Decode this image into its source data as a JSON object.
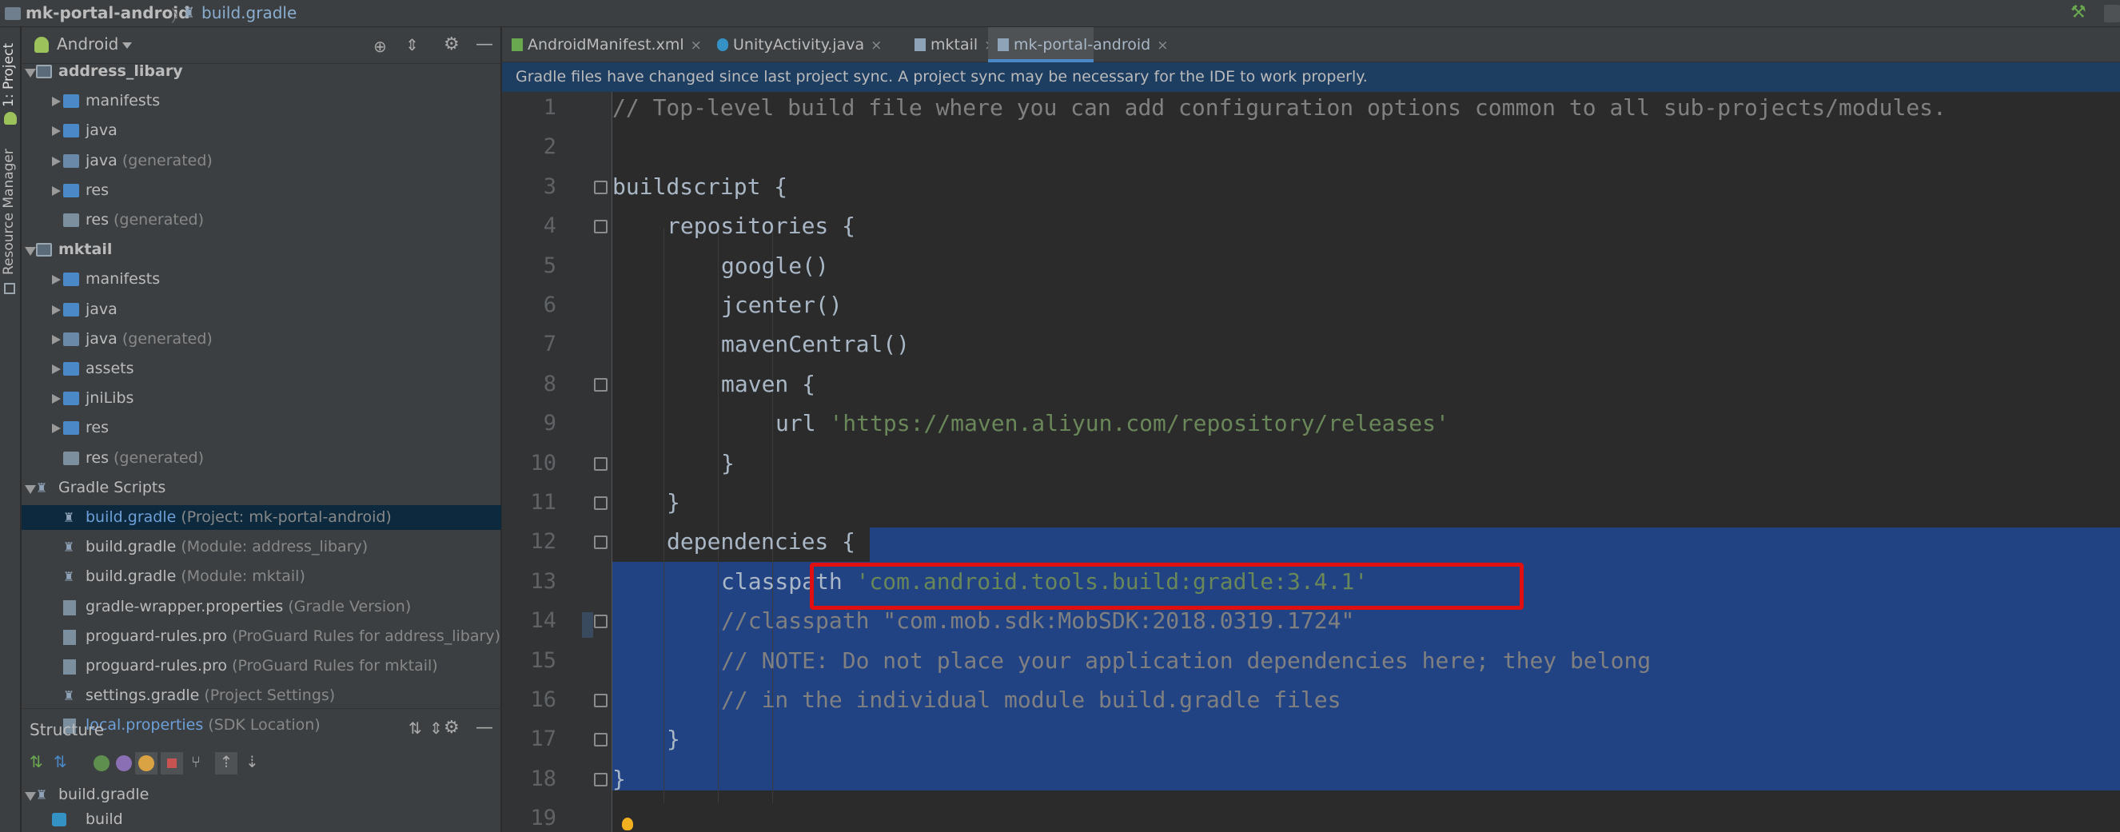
{
  "breadcrumb": {
    "project": "mk-portal-android",
    "file": "build.gradle"
  },
  "left_tool_tabs": {
    "project": "1: Project",
    "resource_manager": "Resource Manager"
  },
  "project_panel": {
    "view_selector": "Android",
    "tree": [
      {
        "label": "address_libary",
        "hint": "",
        "depth": 0,
        "expanded": true,
        "icon": "module-icon",
        "bold": true
      },
      {
        "label": "manifests",
        "hint": "",
        "depth": 1,
        "expanded": false,
        "icon": "folder-icon"
      },
      {
        "label": "java",
        "hint": "",
        "depth": 1,
        "expanded": false,
        "icon": "folder-icon"
      },
      {
        "label": "java",
        "hint": "(generated)",
        "depth": 1,
        "expanded": false,
        "icon": "generated-folder-icon"
      },
      {
        "label": "res",
        "hint": "",
        "depth": 1,
        "expanded": false,
        "icon": "folder-icon"
      },
      {
        "label": "res",
        "hint": "(generated)",
        "depth": 1,
        "expanded": null,
        "icon": "res-folder-icon"
      },
      {
        "label": "mktail",
        "hint": "",
        "depth": 0,
        "expanded": true,
        "icon": "module-icon",
        "bold": true
      },
      {
        "label": "manifests",
        "hint": "",
        "depth": 1,
        "expanded": false,
        "icon": "folder-icon"
      },
      {
        "label": "java",
        "hint": "",
        "depth": 1,
        "expanded": false,
        "icon": "folder-icon"
      },
      {
        "label": "java",
        "hint": "(generated)",
        "depth": 1,
        "expanded": false,
        "icon": "generated-folder-icon"
      },
      {
        "label": "assets",
        "hint": "",
        "depth": 1,
        "expanded": false,
        "icon": "folder-icon"
      },
      {
        "label": "jniLibs",
        "hint": "",
        "depth": 1,
        "expanded": false,
        "icon": "folder-icon"
      },
      {
        "label": "res",
        "hint": "",
        "depth": 1,
        "expanded": false,
        "icon": "folder-icon"
      },
      {
        "label": "res",
        "hint": "(generated)",
        "depth": 1,
        "expanded": null,
        "icon": "res-folder-icon"
      },
      {
        "label": "Gradle Scripts",
        "hint": "",
        "depth": 0,
        "expanded": true,
        "icon": "gradle-icon"
      },
      {
        "label": "build.gradle",
        "hint": "(Project: mk-portal-android)",
        "depth": 1,
        "expanded": null,
        "icon": "gradle-icon",
        "selected": true
      },
      {
        "label": "build.gradle",
        "hint": "(Module: address_libary)",
        "depth": 1,
        "expanded": null,
        "icon": "gradle-icon"
      },
      {
        "label": "build.gradle",
        "hint": "(Module: mktail)",
        "depth": 1,
        "expanded": null,
        "icon": "gradle-icon"
      },
      {
        "label": "gradle-wrapper.properties",
        "hint": "(Gradle Version)",
        "depth": 1,
        "expanded": null,
        "icon": "properties-file-icon"
      },
      {
        "label": "proguard-rules.pro",
        "hint": "(ProGuard Rules for address_libary)",
        "depth": 1,
        "expanded": null,
        "icon": "file-icon"
      },
      {
        "label": "proguard-rules.pro",
        "hint": "(ProGuard Rules for mktail)",
        "depth": 1,
        "expanded": null,
        "icon": "file-icon"
      },
      {
        "label": "settings.gradle",
        "hint": "(Project Settings)",
        "depth": 1,
        "expanded": null,
        "icon": "gradle-icon"
      },
      {
        "label": "local.properties",
        "hint": "(SDK Location)",
        "depth": 1,
        "expanded": null,
        "icon": "properties-file-icon",
        "link_color": true
      }
    ]
  },
  "structure_panel": {
    "title": "Structure",
    "tree": [
      {
        "label": "build.gradle",
        "depth": 0,
        "expanded": true
      },
      {
        "label": "build",
        "depth": 1,
        "expanded": null
      }
    ]
  },
  "editor": {
    "tabs": [
      {
        "label": "AndroidManifest.xml",
        "icon": "xml-file-icon",
        "active": false
      },
      {
        "label": "UnityActivity.java",
        "icon": "java-class-icon",
        "active": false
      },
      {
        "label": "mktail",
        "icon": "gradle-icon",
        "active": false
      },
      {
        "label": "mk-portal-android",
        "icon": "gradle-icon",
        "active": true
      }
    ],
    "notification": "Gradle files have changed since last project sync. A project sync may be necessary for the IDE to work properly.",
    "lines": [
      {
        "n": "1",
        "indent": 0,
        "parts": [
          {
            "t": "// Top-level build file where you can add configuration options common to all sub-projects/modules.",
            "c": "cm"
          }
        ]
      },
      {
        "n": "2",
        "indent": 0,
        "parts": []
      },
      {
        "n": "3",
        "indent": 0,
        "parts": [
          {
            "t": "buildscript {",
            "c": ""
          }
        ]
      },
      {
        "n": "4",
        "indent": 1,
        "parts": [
          {
            "t": "repositories {",
            "c": ""
          }
        ]
      },
      {
        "n": "5",
        "indent": 2,
        "parts": [
          {
            "t": "google()",
            "c": ""
          }
        ]
      },
      {
        "n": "6",
        "indent": 2,
        "parts": [
          {
            "t": "jcenter()",
            "c": ""
          }
        ]
      },
      {
        "n": "7",
        "indent": 2,
        "parts": [
          {
            "t": "mavenCentral()",
            "c": ""
          }
        ]
      },
      {
        "n": "8",
        "indent": 2,
        "parts": [
          {
            "t": "maven {",
            "c": ""
          }
        ]
      },
      {
        "n": "9",
        "indent": 3,
        "parts": [
          {
            "t": "url ",
            "c": ""
          },
          {
            "t": "'https://maven.aliyun.com/repository/releases'",
            "c": "st"
          }
        ]
      },
      {
        "n": "10",
        "indent": 2,
        "parts": [
          {
            "t": "}",
            "c": ""
          }
        ]
      },
      {
        "n": "11",
        "indent": 1,
        "parts": [
          {
            "t": "}",
            "c": ""
          }
        ]
      },
      {
        "n": "12",
        "indent": 1,
        "parts": [
          {
            "t": "dependencies {",
            "c": ""
          }
        ]
      },
      {
        "n": "13",
        "indent": 2,
        "parts": [
          {
            "t": "classpath ",
            "c": ""
          },
          {
            "t": "'com.android.tools.build:gradle:3.4.1'",
            "c": "st"
          }
        ]
      },
      {
        "n": "14",
        "indent": 2,
        "parts": [
          {
            "t": "//classpath \"com.mob.sdk:MobSDK:2018.0319.1724\"",
            "c": "cm"
          }
        ]
      },
      {
        "n": "15",
        "indent": 2,
        "parts": [
          {
            "t": "// NOTE: Do not place your application dependencies here; they belong",
            "c": "cm"
          }
        ]
      },
      {
        "n": "16",
        "indent": 2,
        "parts": [
          {
            "t": "// in the individual module build.gradle files",
            "c": "cm"
          }
        ]
      },
      {
        "n": "17",
        "indent": 1,
        "parts": [
          {
            "t": "}",
            "c": ""
          }
        ]
      },
      {
        "n": "18",
        "indent": 0,
        "parts": [
          {
            "t": "}",
            "c": ""
          }
        ]
      },
      {
        "n": "19",
        "indent": 0,
        "parts": []
      }
    ],
    "folded_marker_lines": [
      "3",
      "4",
      "8",
      "10",
      "11",
      "12",
      "14",
      "16",
      "17",
      "18"
    ],
    "highlighted_line": "13",
    "selection": {
      "from_line": "12",
      "to_line": "18"
    }
  },
  "colors": {
    "selection": "#214283",
    "banner": "#1d3d61",
    "highlight_box": "#e01010",
    "string": "#6a8759",
    "comment": "#808080"
  }
}
